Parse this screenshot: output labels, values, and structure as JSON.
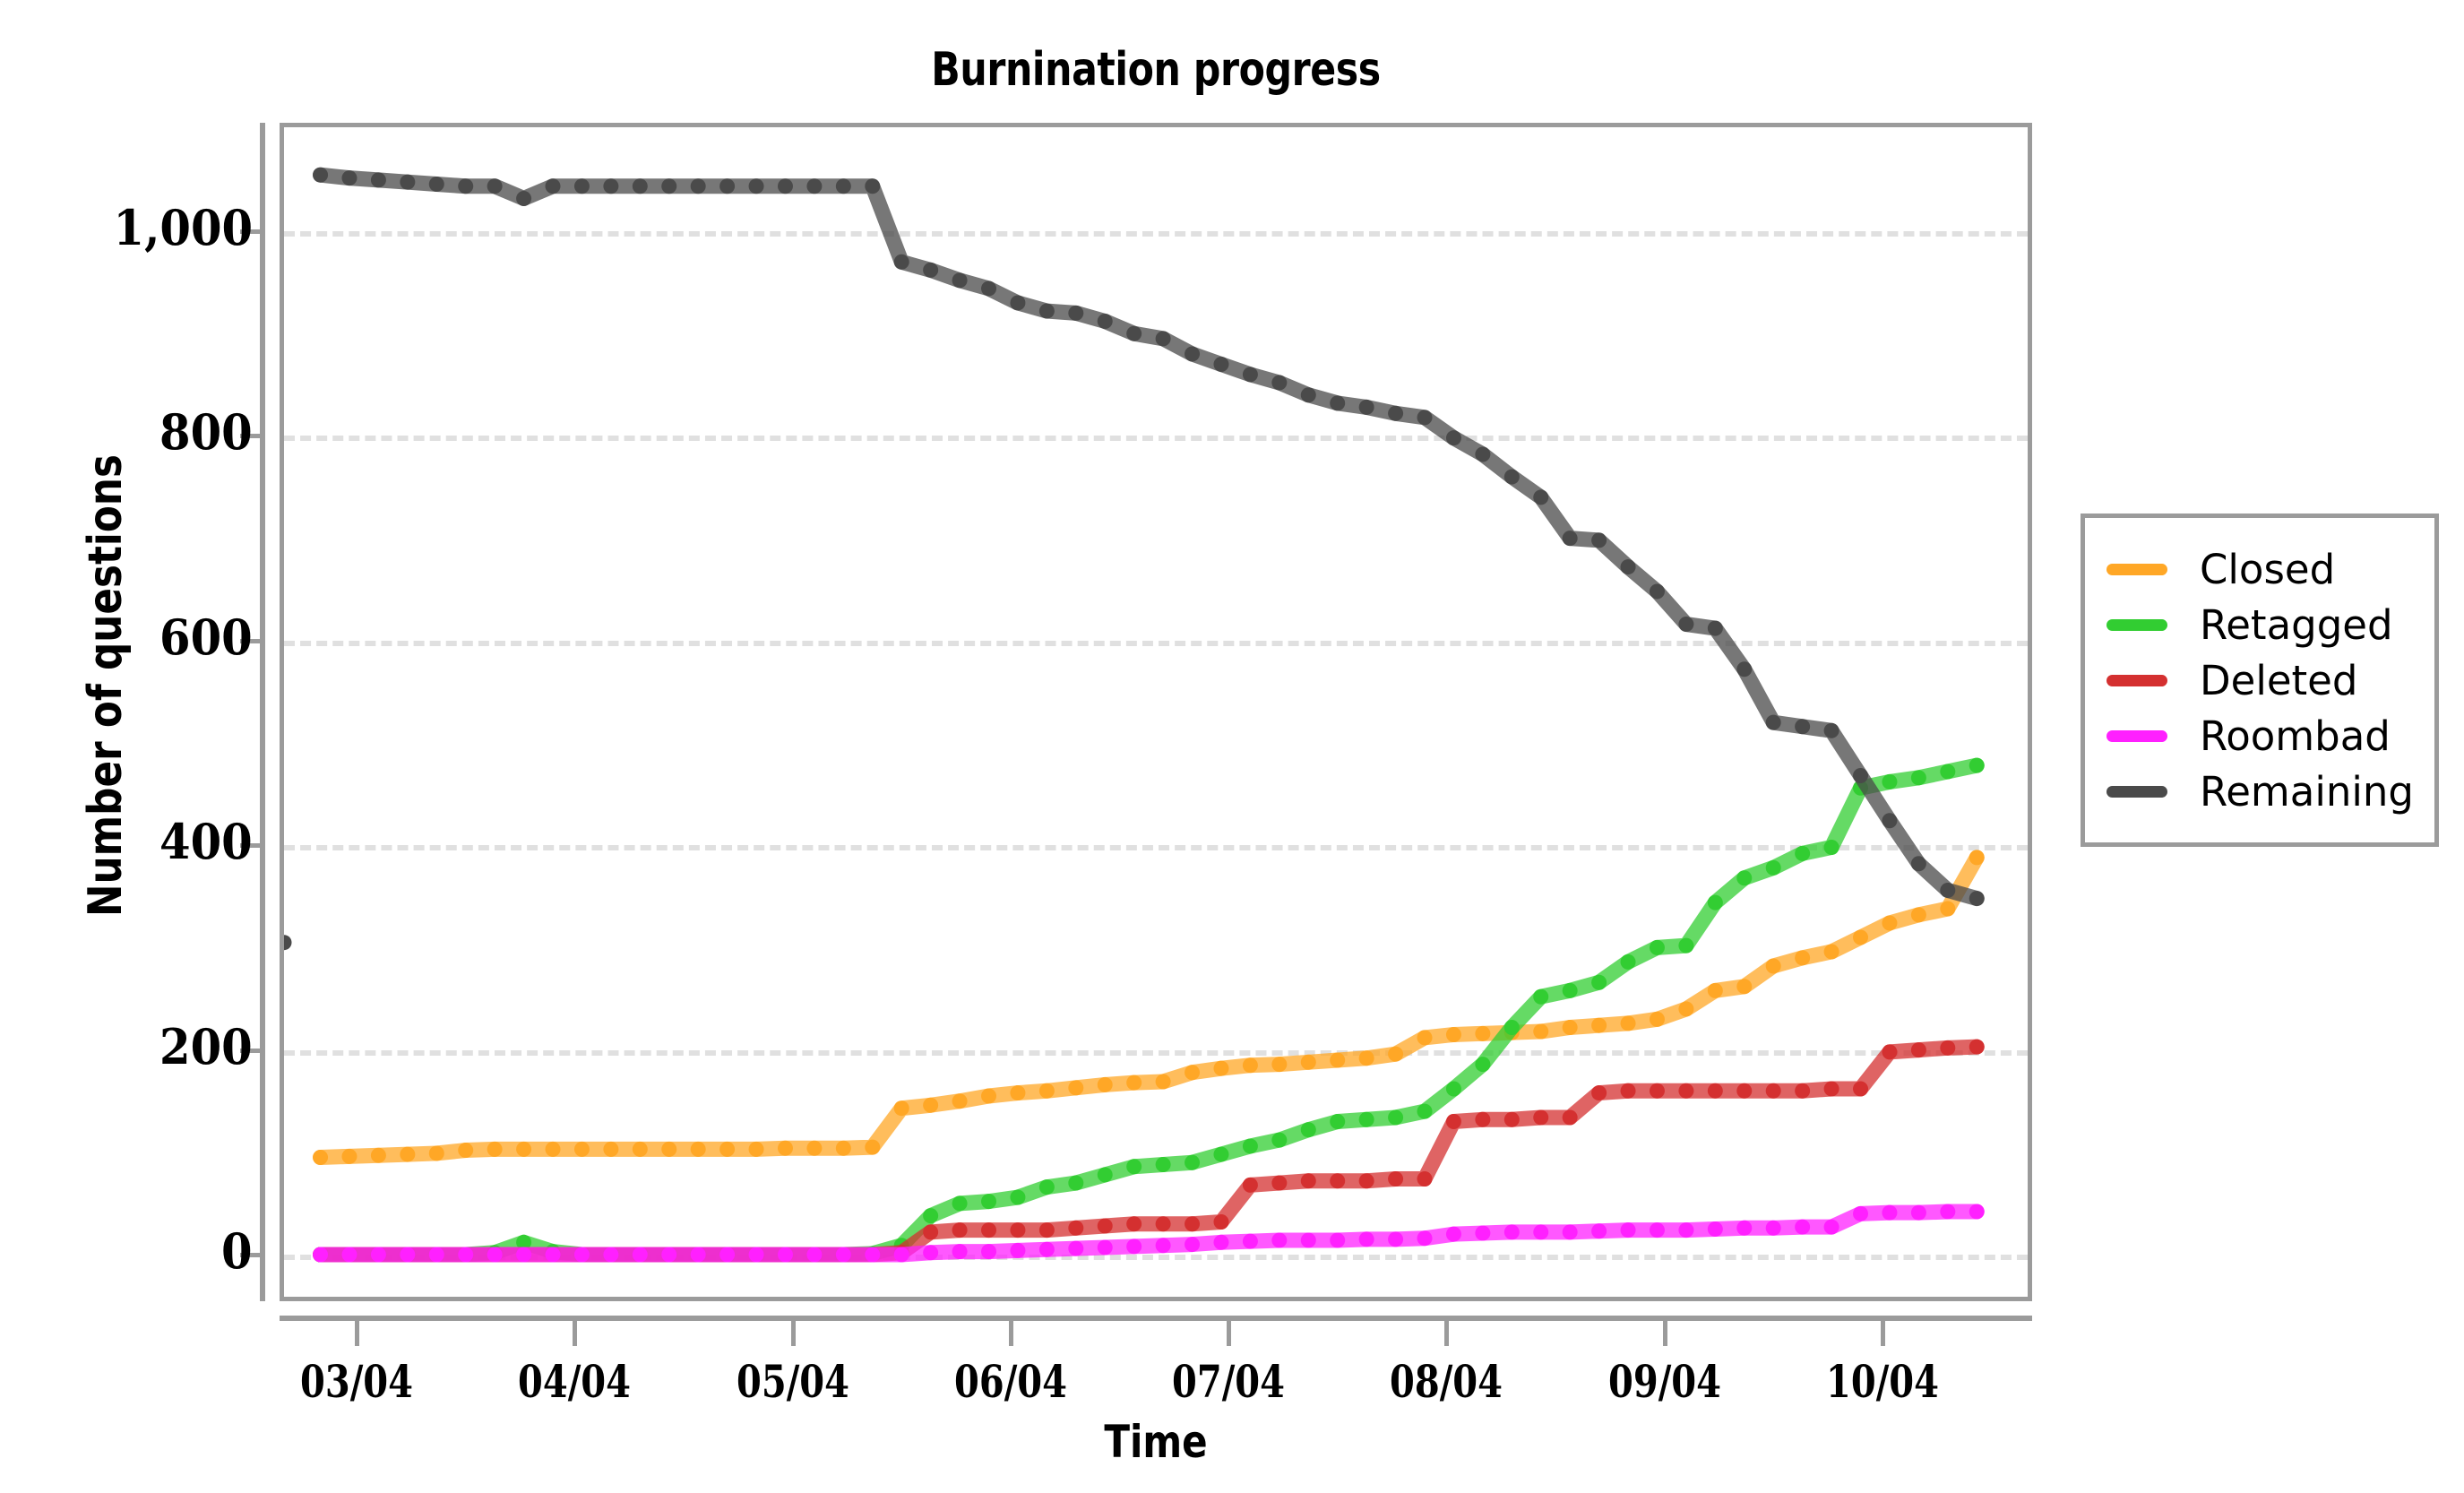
{
  "chart_data": {
    "type": "line",
    "title": "Burnination progress",
    "xlabel": "Time",
    "ylabel": "Number of questions",
    "grid": true,
    "legend_position": "right",
    "ylim": [
      -40,
      1100
    ],
    "yticks": [
      0,
      200,
      400,
      600,
      800,
      1000
    ],
    "ytick_labels": [
      "0",
      "200",
      "400",
      "600",
      "800",
      "1,000"
    ],
    "xlim": [
      0,
      48
    ],
    "xticks": [
      2,
      8,
      14,
      20,
      26,
      32,
      38,
      44
    ],
    "xtick_labels": [
      "03/04",
      "04/04",
      "05/04",
      "06/04",
      "07/04",
      "08/04",
      "09/04",
      "10/04"
    ],
    "x": [
      1,
      1.8,
      2.6,
      3.4,
      4.2,
      5,
      5.8,
      6.6,
      7.4,
      8.2,
      9,
      9.8,
      10.6,
      11.4,
      12.2,
      13,
      13.8,
      14.6,
      15.4,
      16.2,
      17,
      17.8,
      18.6,
      19.4,
      20.2,
      21,
      21.8,
      22.6,
      23.4,
      24.2,
      25,
      25.8,
      26.6,
      27.4,
      28.2,
      29,
      29.8,
      30.6,
      31.4,
      32.2,
      33,
      33.8,
      34.6,
      35.4,
      36.2,
      37,
      37.8,
      38.6,
      39.4,
      40.2,
      41,
      41.8,
      42.6,
      43.4,
      44.2,
      45,
      45.8,
      46.6
    ],
    "series": [
      {
        "name": "Closed",
        "color": "#FFA726",
        "values": [
          95,
          96,
          97,
          98,
          99,
          102,
          103,
          103,
          103,
          103,
          103,
          103,
          103,
          103,
          103,
          103,
          104,
          104,
          104,
          105,
          143,
          146,
          150,
          155,
          158,
          160,
          163,
          166,
          168,
          169,
          178,
          182,
          185,
          186,
          188,
          190,
          192,
          196,
          212,
          215,
          216,
          217,
          218,
          222,
          224,
          226,
          230,
          240,
          258,
          262,
          282,
          290,
          296,
          310,
          324,
          332,
          338,
          388
        ]
      },
      {
        "name": "Retagged",
        "color": "#32CD32",
        "values": [
          0,
          0,
          0,
          0,
          0,
          0,
          2,
          12,
          3,
          0,
          0,
          0,
          0,
          0,
          0,
          0,
          0,
          0,
          0,
          1,
          9,
          38,
          50,
          52,
          56,
          66,
          70,
          78,
          86,
          88,
          90,
          98,
          106,
          112,
          122,
          130,
          132,
          134,
          140,
          162,
          186,
          222,
          252,
          258,
          266,
          286,
          300,
          302,
          344,
          368,
          378,
          392,
          398,
          456,
          462,
          466,
          472,
          478
        ]
      },
      {
        "name": "Deleted",
        "color": "#D43030",
        "values": [
          0,
          0,
          0,
          0,
          0,
          0,
          0,
          0,
          0,
          0,
          0,
          0,
          0,
          0,
          0,
          0,
          0,
          0,
          0,
          0,
          2,
          22,
          24,
          24,
          24,
          24,
          26,
          28,
          30,
          30,
          30,
          32,
          68,
          70,
          72,
          72,
          72,
          74,
          74,
          130,
          132,
          132,
          134,
          134,
          158,
          160,
          160,
          160,
          160,
          160,
          160,
          160,
          162,
          162,
          198,
          200,
          202,
          203
        ]
      },
      {
        "name": "Roombad",
        "color": "#FF20FF",
        "values": [
          0,
          0,
          0,
          0,
          0,
          0,
          0,
          0,
          0,
          0,
          0,
          0,
          0,
          0,
          0,
          0,
          0,
          0,
          0,
          0,
          0,
          2,
          3,
          3,
          4,
          5,
          6,
          7,
          8,
          9,
          10,
          12,
          13,
          14,
          14,
          14,
          15,
          15,
          16,
          20,
          21,
          22,
          22,
          22,
          23,
          24,
          24,
          24,
          25,
          26,
          26,
          27,
          27,
          40,
          41,
          41,
          42,
          42
        ]
      },
      {
        "name": "Remaining",
        "color": "#4A4A4A",
        "values": [
          1055,
          1052,
          1050,
          1048,
          1046,
          1044,
          1044,
          1032,
          1044,
          1044,
          1044,
          1044,
          1044,
          1044,
          1044,
          1044,
          1044,
          1044,
          1044,
          1044,
          970,
          962,
          952,
          944,
          930,
          922,
          920,
          912,
          900,
          895,
          880,
          870,
          860,
          852,
          840,
          832,
          828,
          822,
          818,
          798,
          782,
          760,
          740,
          700,
          698,
          672,
          648,
          616,
          612,
          572,
          520,
          516,
          512,
          468,
          424,
          382,
          356,
          348,
          305
        ]
      }
    ]
  },
  "legend": {
    "items": [
      {
        "label": "Closed",
        "color": "#FFA726"
      },
      {
        "label": "Retagged",
        "color": "#32CD32"
      },
      {
        "label": "Deleted",
        "color": "#D43030"
      },
      {
        "label": "Roombad",
        "color": "#FF20FF"
      },
      {
        "label": "Remaining",
        "color": "#4A4A4A"
      }
    ]
  }
}
